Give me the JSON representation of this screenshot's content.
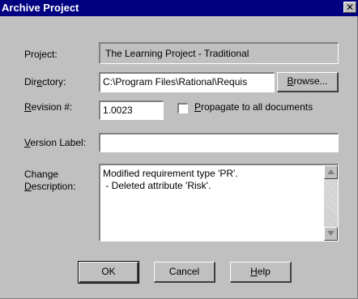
{
  "window": {
    "title": "Archive Project",
    "close_glyph": "✕"
  },
  "labels": {
    "project": "Project:",
    "directory_pre": "Dir",
    "directory_u": "e",
    "directory_post": "ctory:",
    "revision_u": "R",
    "revision_post": "evision #:",
    "version_u": "V",
    "version_post": "ersion Label:",
    "change_line1": "Change",
    "change_u": "D",
    "change_line2_post": "escription:"
  },
  "fields": {
    "project": "The Learning Project - Traditional",
    "directory": "C:\\Program Files\\Rational\\Requis",
    "revision": "1.0023",
    "version_label": "",
    "change_description": [
      "Modified requirement type 'PR'.",
      " - Deleted attribute 'Risk'."
    ]
  },
  "checkbox": {
    "u": "P",
    "label_post": "ropagate to all documents",
    "checked": false
  },
  "buttons": {
    "browse_u": "B",
    "browse_post": "rowse...",
    "ok": "OK",
    "cancel": "Cancel",
    "help_u": "H",
    "help_post": "elp"
  },
  "icons": {
    "scroll_up": "triangle-up-icon",
    "scroll_down": "triangle-down-icon",
    "close": "close-icon"
  }
}
